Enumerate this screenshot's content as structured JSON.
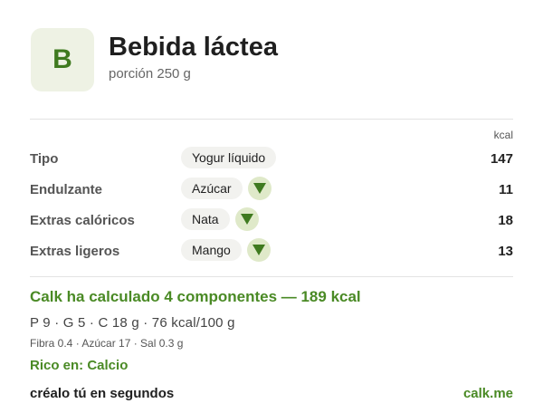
{
  "logo_letter": "B",
  "title": "Bebida láctea",
  "subtitle": "porción 250 g",
  "unit_label": "kcal",
  "rows": [
    {
      "label": "Tipo",
      "value": "Yogur líquido",
      "kcal": "147",
      "dropdown": false
    },
    {
      "label": "Endulzante",
      "value": "Azúcar",
      "kcal": "11",
      "dropdown": true
    },
    {
      "label": "Extras calóricos",
      "value": "Nata",
      "kcal": "18",
      "dropdown": true
    },
    {
      "label": "Extras ligeros",
      "value": "Mango",
      "kcal": "13",
      "dropdown": true
    }
  ],
  "summary": {
    "calc": "Calk ha calculado 4 componentes — 189 kcal",
    "macros": "P 9 · G 5 · C 18 g   ·   76 kcal/100 g",
    "micro": "Fibra 0.4 · Azúcar 17 · Sal 0.3 g",
    "rich": "Rico en: Calcio"
  },
  "footer": {
    "cta": "créalo tú en segundos",
    "link": "calk.me"
  },
  "colors": {
    "accent": "#4a8a25",
    "logo_bg": "#eef2e4",
    "dropdown_bg": "#dfe9c9",
    "dropdown_arrow": "#3f7a1f"
  },
  "icons": {
    "dropdown": "triangle-down-icon"
  }
}
